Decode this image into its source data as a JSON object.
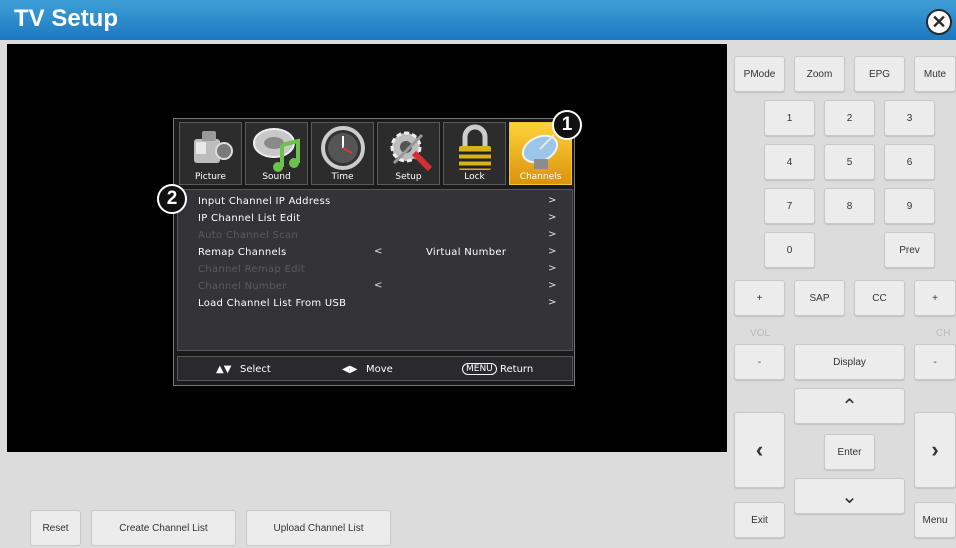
{
  "window": {
    "title": "TV Setup"
  },
  "tabs": [
    {
      "label": "Picture",
      "icon": "camera-icon"
    },
    {
      "label": "Sound",
      "icon": "music-note-icon"
    },
    {
      "label": "Time",
      "icon": "clock-icon"
    },
    {
      "label": "Setup",
      "icon": "tools-icon"
    },
    {
      "label": "Lock",
      "icon": "padlock-icon"
    },
    {
      "label": "Channels",
      "icon": "satellite-dish-icon",
      "active": true
    }
  ],
  "menu": {
    "items": [
      {
        "label": "Input Channel IP Address",
        "enabled": true
      },
      {
        "label": "IP Channel List Edit",
        "enabled": true
      },
      {
        "label": "Auto Channel Scan",
        "enabled": false
      },
      {
        "label": "Remap Channels",
        "value": "Virtual Number",
        "enabled": true
      },
      {
        "label": "Channel Remap Edit",
        "enabled": false
      },
      {
        "label": "Channel Number",
        "enabled": false
      },
      {
        "label": "Load Channel List From USB",
        "enabled": true
      }
    ],
    "arrow_left": "<",
    "arrow_right": ">"
  },
  "hints": {
    "select": "Select",
    "move": "Move",
    "menu_key": "MENU",
    "return": "Return"
  },
  "callouts": {
    "one": "1",
    "two": "2"
  },
  "remote": {
    "pmode": "PMode",
    "zoom": "Zoom",
    "epg": "EPG",
    "mute": "Mute",
    "digits": [
      "1",
      "2",
      "3",
      "4",
      "5",
      "6",
      "7",
      "8",
      "9",
      "0"
    ],
    "prev": "Prev",
    "plus": "+",
    "minus": "-",
    "sap": "SAP",
    "cc": "CC",
    "vol_label": "VOL",
    "ch_label": "CH",
    "display": "Display",
    "enter": "Enter",
    "exit": "Exit",
    "menu": "Menu"
  },
  "bottom": {
    "reset": "Reset",
    "create": "Create Channel List",
    "upload": "Upload Channel List"
  },
  "colors": {
    "title_bar": "#2a8ccd",
    "active_tab": "#f4b81c",
    "osd_list_bg": "#333338"
  }
}
